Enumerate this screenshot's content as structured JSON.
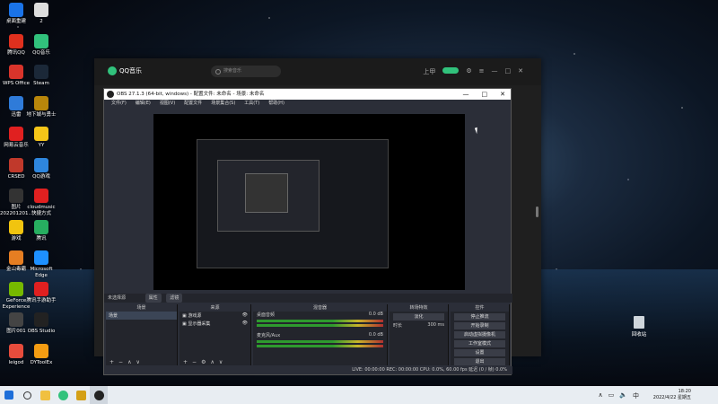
{
  "desktop": {
    "icons": [
      {
        "label": "桌面重建",
        "color": "#1a73e8"
      },
      {
        "label": "2",
        "color": "#dddddd"
      },
      {
        "label": "腾讯QQ",
        "color": "#e0301e"
      },
      {
        "label": "QQ音乐",
        "color": "#31c27c"
      },
      {
        "label": "WPS Office",
        "color": "#d9342b"
      },
      {
        "label": "Steam",
        "color": "#1b2838"
      },
      {
        "label": "迅雷",
        "color": "#2f7bd9"
      },
      {
        "label": "地下城与勇士",
        "color": "#b8860b"
      },
      {
        "label": "网易云音乐",
        "color": "#e02020"
      },
      {
        "label": "YY",
        "color": "#f5c518"
      },
      {
        "label": "CRSED",
        "color": "#c0392b"
      },
      {
        "label": "QQ游戏",
        "color": "#2e86de"
      },
      {
        "label": "图片\n202201201...",
        "color": "#333333"
      },
      {
        "label": "cloudmusic\n快捷方式",
        "color": "#e02020"
      },
      {
        "label": "游戏",
        "color": "#f1c40f"
      },
      {
        "label": "腾讯",
        "color": "#27ae60"
      },
      {
        "label": "金山毒霸",
        "color": "#e67e22"
      },
      {
        "label": "Microsoft\nEdge",
        "color": "#1e90ff"
      },
      {
        "label": "GeForce\nExperience",
        "color": "#76b900"
      },
      {
        "label": "腾讯手游助手",
        "color": "#e02020"
      },
      {
        "label": "图片001",
        "color": "#444444"
      },
      {
        "label": "OBS Studio",
        "color": "#222222"
      },
      {
        "label": "leigod",
        "color": "#e74c3c"
      },
      {
        "label": "DYToolEx",
        "color": "#f39c12"
      }
    ],
    "recycle_bin": "回收站"
  },
  "qqmusic": {
    "logo": "QQ音乐",
    "search_placeholder": "搜索音乐",
    "user": "上甲"
  },
  "obs": {
    "title": "OBS 27.1.3 (64-bit, windows) - 配置文件: 未命名 - 场景: 未命名",
    "menu": [
      "文件(F)",
      "编辑(E)",
      "视图(V)",
      "配置文件",
      "场景集合(S)",
      "工具(T)",
      "帮助(H)"
    ],
    "no_source": "未选择源",
    "props_btn": "属性",
    "filters_btn": "滤镜",
    "docks": {
      "scenes": {
        "title": "场景",
        "items": [
          "场景"
        ]
      },
      "sources": {
        "title": "来源",
        "items": [
          "游戏源",
          "显示器采集"
        ]
      },
      "mixer": {
        "title": "混音器",
        "channels": [
          {
            "name": "桌面音频",
            "level": "0.0 dB"
          },
          {
            "name": "麦克风/Aux",
            "level": "0.0 dB"
          }
        ]
      },
      "transitions": {
        "title": "转场特效",
        "type": "淡化",
        "duration_label": "时长",
        "duration": "300 ms"
      },
      "controls": {
        "title": "控件",
        "buttons": [
          "停止推流",
          "开始录制",
          "启动虚拟摄像机",
          "工作室模式",
          "设置",
          "退出"
        ]
      }
    },
    "status": "LIVE: 00:00:00   REC: 00:00:00   CPU: 0.0%, 60.00 fps   延迟 (0 / 帧) 0.0%"
  },
  "taskbar": {
    "time": "18:20",
    "date": "2022/4/22 星期五"
  }
}
